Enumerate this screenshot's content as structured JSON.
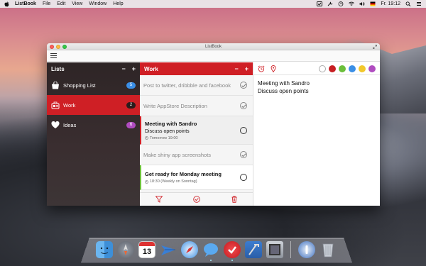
{
  "menubar": {
    "app_name": "ListBook",
    "items": [
      "File",
      "Edit",
      "View",
      "Window",
      "Help"
    ],
    "clock": "Fr. 19:12"
  },
  "window": {
    "title": "ListBook"
  },
  "lists_pane": {
    "title": "Lists",
    "minus_label": "−",
    "plus_label": "+",
    "items": [
      {
        "label": "Shopping List",
        "count": "5",
        "badge_color": "#3b8fe6",
        "icon": "shopping-bag-icon"
      },
      {
        "label": "Work",
        "count": "2",
        "badge_color": "#2a1c1c",
        "icon": "briefcase-icon"
      },
      {
        "label": "Ideas",
        "count": "6",
        "badge_color": "#b04cc0",
        "icon": "heart-icon"
      }
    ]
  },
  "tasks_pane": {
    "title": "Work",
    "minus_label": "−",
    "plus_label": "+",
    "tasks": [
      {
        "title": "Post to twitter, dribbble and facebook",
        "done": true
      },
      {
        "title": "Write AppStore Description",
        "done": true
      },
      {
        "title": "Meeting with Sandro",
        "note": "Discuss open points",
        "reminder": "Tomorrow 19:00",
        "done": false
      },
      {
        "title": "Make shiny app screenshots",
        "done": true
      },
      {
        "title": "Get ready for Monday meeting",
        "reminder": "18:30 (Weekly on Sonntag)",
        "done": false
      }
    ]
  },
  "detail_pane": {
    "note_line1": "Meeting with Sandro",
    "note_line2": "Discuss open points",
    "colors": [
      "#ffffff",
      "#c71e22",
      "#6bbf3a",
      "#3b8fe6",
      "#f2c82c",
      "#b04cc0"
    ]
  },
  "dock": {
    "icons": [
      "finder-icon",
      "launchpad-icon",
      "calendar-icon",
      "mail-icon",
      "safari-icon",
      "messages-icon",
      "listbook-icon",
      "xcode-icon",
      "preview-icon",
      "onepassword-icon",
      "trash-icon"
    ],
    "calendar_day": "13"
  },
  "colors": {
    "accent": "#cf1f25",
    "sidebar_bg": "#2e2526"
  }
}
